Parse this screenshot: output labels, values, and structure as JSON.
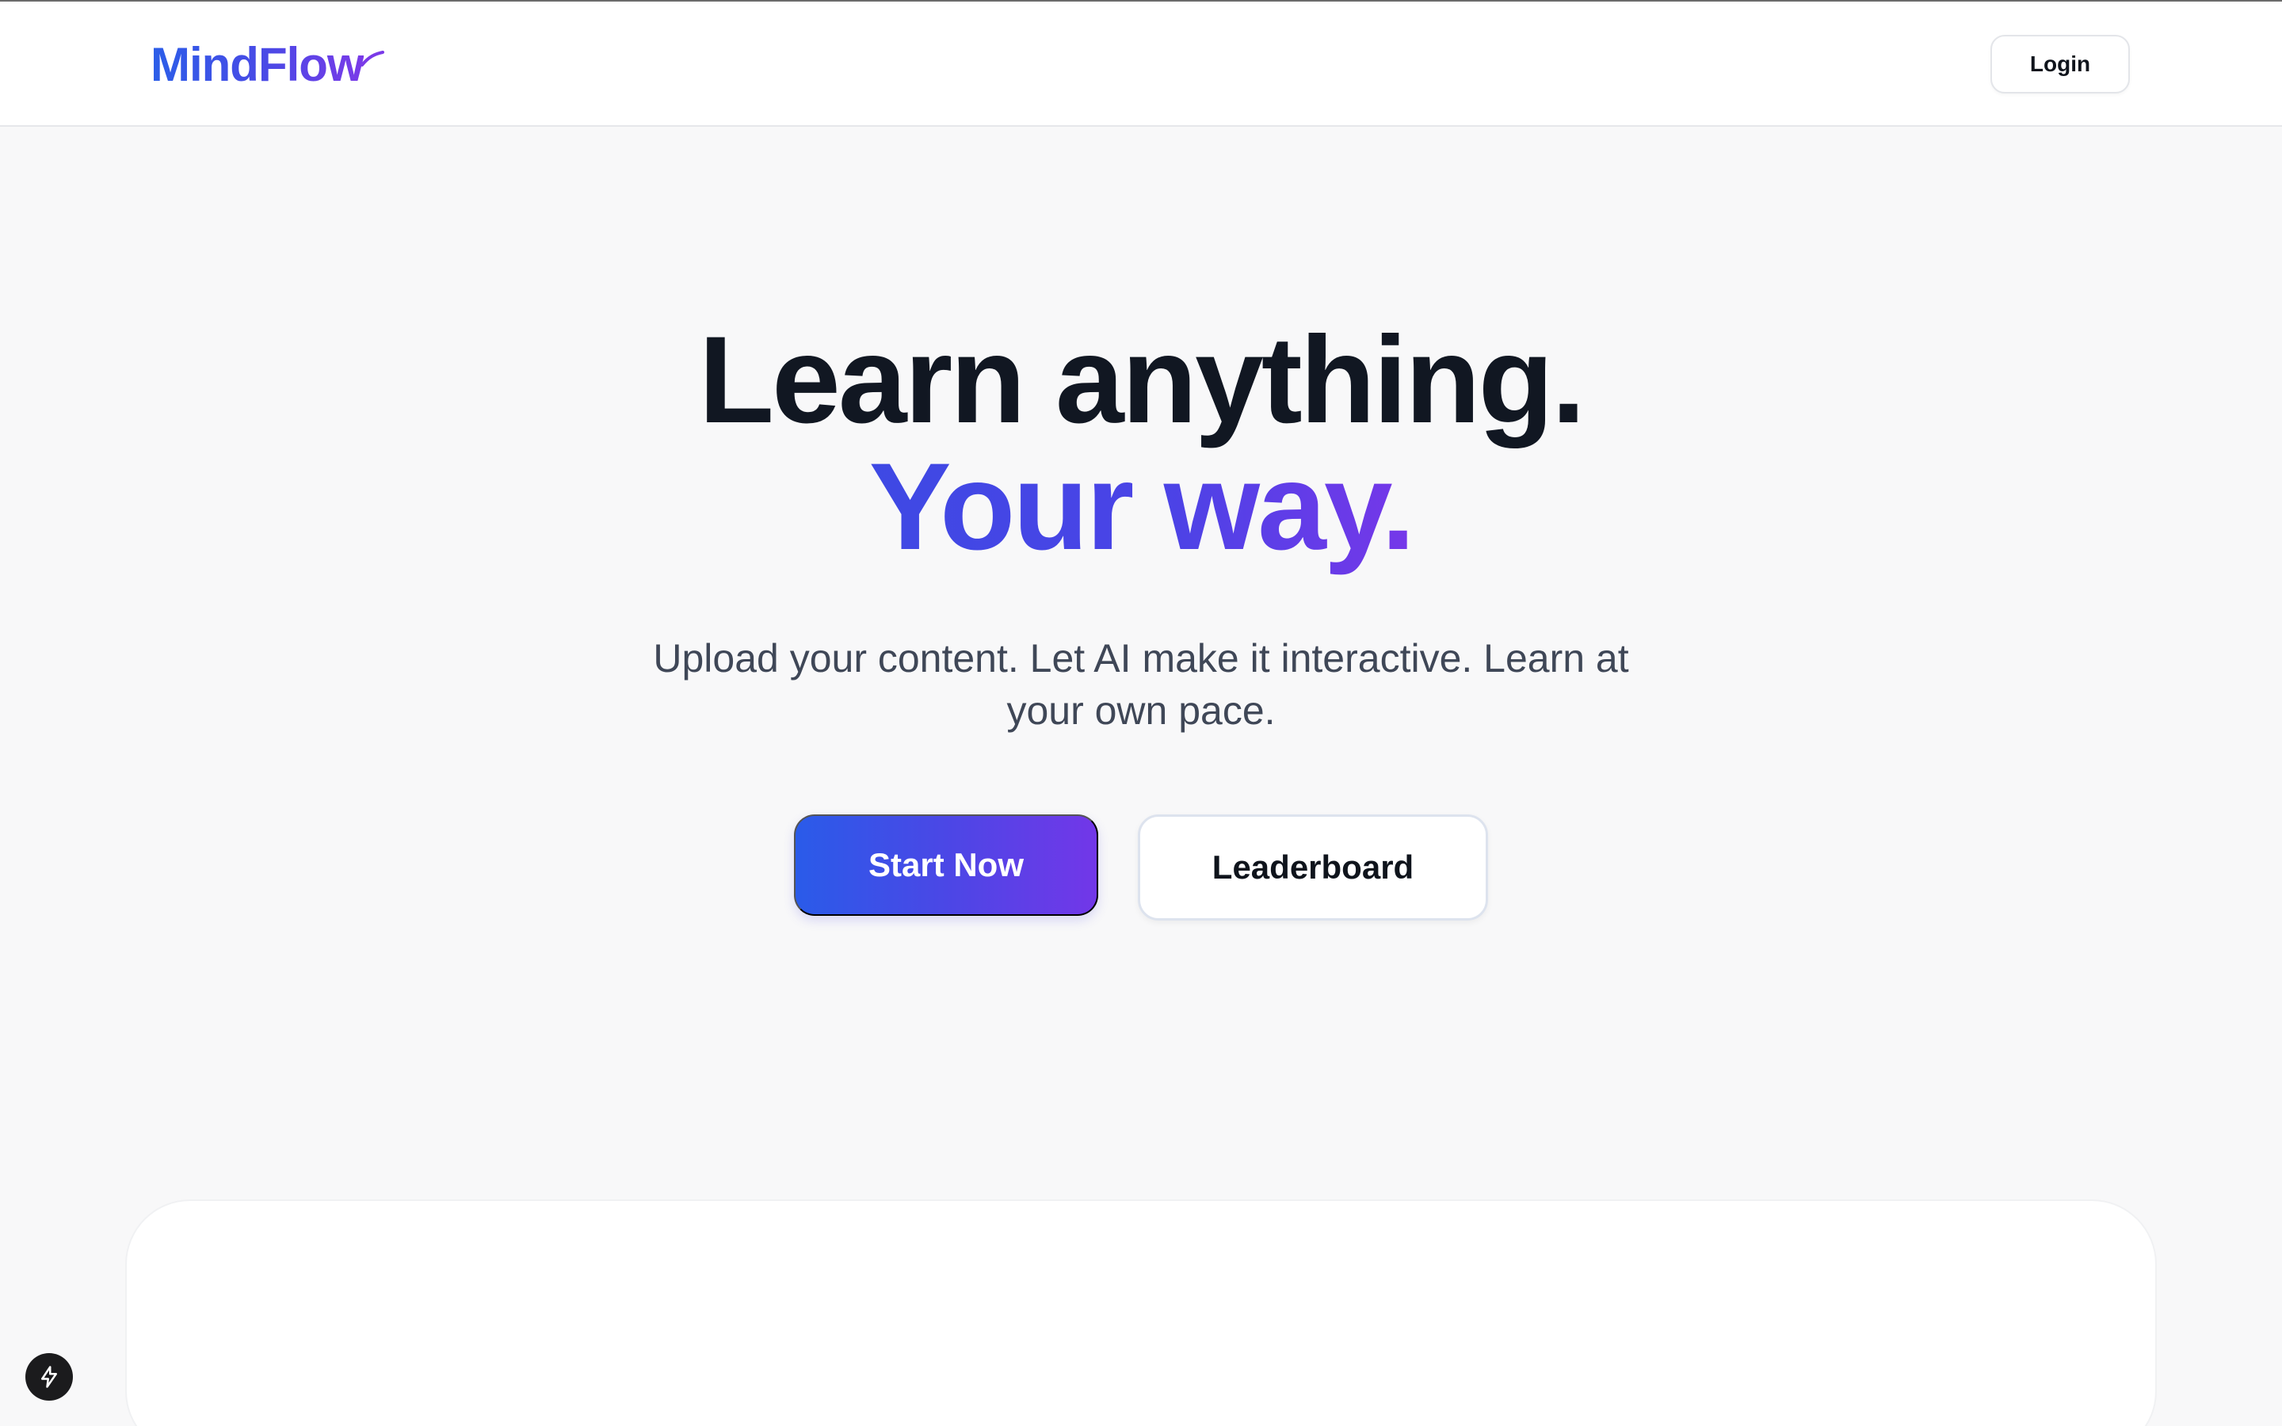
{
  "header": {
    "logo_text": "MindFlow",
    "login_label": "Login"
  },
  "hero": {
    "title_line1": "Learn anything.",
    "title_line2": "Your way.",
    "description": "Upload your content. Let AI make it interactive. Learn at your own pace.",
    "primary_cta": "Start Now",
    "secondary_cta": "Leaderboard"
  },
  "colors": {
    "brand_blue": "#2b5ee8",
    "brand_purple": "#7237e8",
    "heading_dark": "#111722",
    "background": "#f8f8f9"
  },
  "icons": {
    "logo_mark": "swoosh-icon",
    "floating_action": "lightning-bolt-icon"
  }
}
